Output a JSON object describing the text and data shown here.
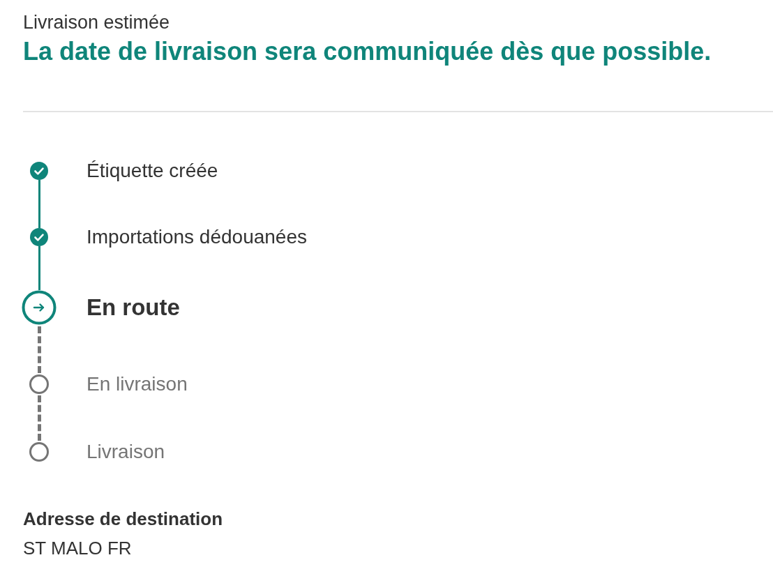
{
  "estimate": {
    "label": "Livraison estimée",
    "message": "La date de livraison sera communiquée dès que possible."
  },
  "steps": [
    {
      "label": "Étiquette créée",
      "kind": "done"
    },
    {
      "label": "Importations dédouanées",
      "kind": "done"
    },
    {
      "label": "En route",
      "kind": "current"
    },
    {
      "label": "En livraison",
      "kind": "pending"
    },
    {
      "label": "Livraison",
      "kind": "pending"
    }
  ],
  "destination": {
    "label": "Adresse de destination",
    "value": "ST MALO FR"
  }
}
